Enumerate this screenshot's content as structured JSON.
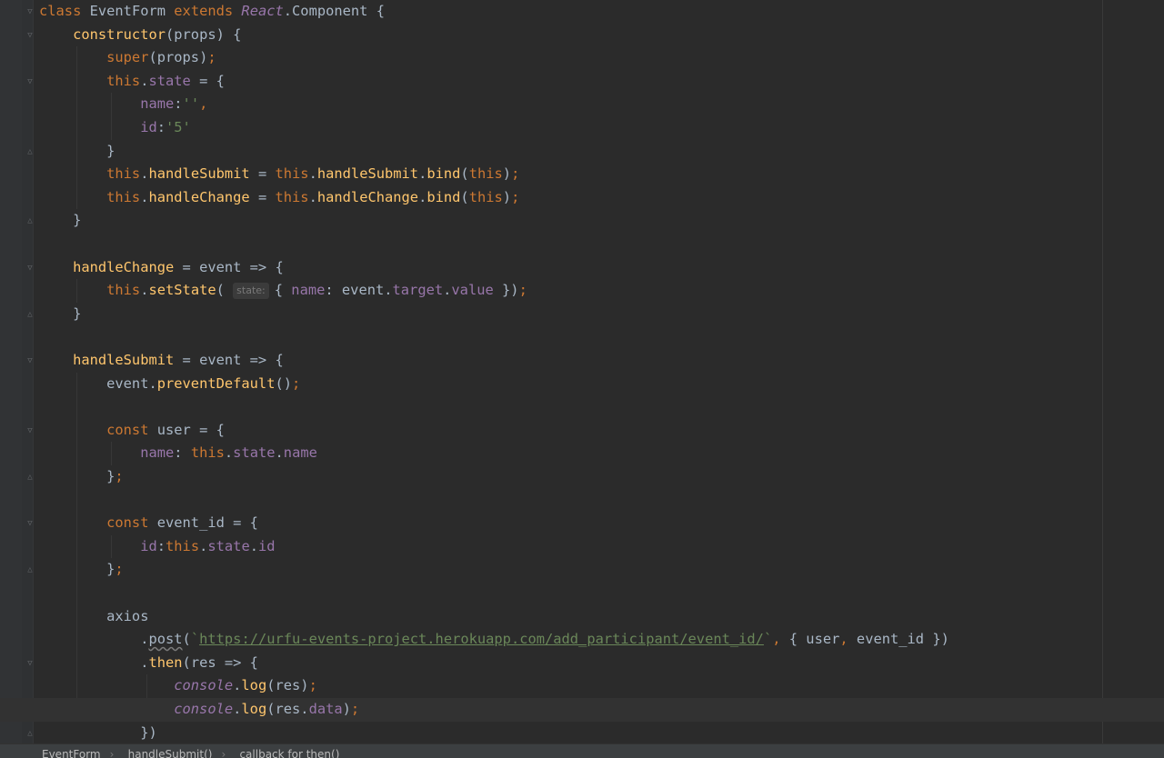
{
  "lines": [
    [
      [
        "kw",
        "class "
      ],
      [
        "cls",
        "EventForm "
      ],
      [
        "kw",
        "extends "
      ],
      [
        "react",
        "React"
      ],
      [
        "plain",
        ".Component {"
      ]
    ],
    [
      [
        "fn",
        "    constructor"
      ],
      [
        "plain",
        "(props) {"
      ]
    ],
    [
      [
        "kw",
        "        super"
      ],
      [
        "plain",
        "(props)"
      ],
      [
        "punc",
        ";"
      ]
    ],
    [
      [
        "kw",
        "        this"
      ],
      [
        "plain",
        "."
      ],
      [
        "prop",
        "state"
      ],
      [
        "plain",
        " = {"
      ]
    ],
    [
      [
        "prop",
        "            name"
      ],
      [
        "plain",
        ":"
      ],
      [
        "str",
        "''"
      ],
      [
        "punc",
        ","
      ]
    ],
    [
      [
        "prop",
        "            id"
      ],
      [
        "plain",
        ":"
      ],
      [
        "str",
        "'5'"
      ]
    ],
    [
      [
        "plain",
        "        }"
      ]
    ],
    [
      [
        "kw",
        "        this"
      ],
      [
        "plain",
        "."
      ],
      [
        "fn",
        "handleSubmit"
      ],
      [
        "plain",
        " = "
      ],
      [
        "kw",
        "this"
      ],
      [
        "plain",
        "."
      ],
      [
        "fn",
        "handleSubmit"
      ],
      [
        "plain",
        "."
      ],
      [
        "fn",
        "bind"
      ],
      [
        "plain",
        "("
      ],
      [
        "kw",
        "this"
      ],
      [
        "plain",
        ")"
      ],
      [
        "punc",
        ";"
      ]
    ],
    [
      [
        "kw",
        "        this"
      ],
      [
        "plain",
        "."
      ],
      [
        "fn",
        "handleChange"
      ],
      [
        "plain",
        " = "
      ],
      [
        "kw",
        "this"
      ],
      [
        "plain",
        "."
      ],
      [
        "fn",
        "handleChange"
      ],
      [
        "plain",
        "."
      ],
      [
        "fn",
        "bind"
      ],
      [
        "plain",
        "("
      ],
      [
        "kw",
        "this"
      ],
      [
        "plain",
        ")"
      ],
      [
        "punc",
        ";"
      ]
    ],
    [
      [
        "plain",
        "    }"
      ]
    ],
    [],
    [
      [
        "fn",
        "    handleChange"
      ],
      [
        "plain",
        " = event => {"
      ]
    ],
    [
      [
        "kw",
        "        this"
      ],
      [
        "plain",
        "."
      ],
      [
        "fn",
        "setState"
      ],
      [
        "plain",
        "( "
      ],
      [
        "hint",
        "state:"
      ],
      [
        "plain",
        "{ "
      ],
      [
        "prop",
        "name"
      ],
      [
        "plain",
        ": event."
      ],
      [
        "prop",
        "target"
      ],
      [
        "plain",
        "."
      ],
      [
        "prop",
        "value"
      ],
      [
        "plain",
        " })"
      ],
      [
        "punc",
        ";"
      ]
    ],
    [
      [
        "plain",
        "    }"
      ]
    ],
    [],
    [
      [
        "fn",
        "    handleSubmit"
      ],
      [
        "plain",
        " = event => {"
      ]
    ],
    [
      [
        "plain",
        "        event."
      ],
      [
        "fn",
        "preventDefault"
      ],
      [
        "plain",
        "()"
      ],
      [
        "punc",
        ";"
      ]
    ],
    [],
    [
      [
        "kw",
        "        const "
      ],
      [
        "plain",
        "user = {"
      ]
    ],
    [
      [
        "prop",
        "            name"
      ],
      [
        "plain",
        ": "
      ],
      [
        "kw",
        "this"
      ],
      [
        "plain",
        "."
      ],
      [
        "prop",
        "state"
      ],
      [
        "plain",
        "."
      ],
      [
        "prop",
        "name"
      ]
    ],
    [
      [
        "plain",
        "        }"
      ],
      [
        "punc",
        ";"
      ]
    ],
    [],
    [
      [
        "kw",
        "        const "
      ],
      [
        "plain",
        "event_id = {"
      ]
    ],
    [
      [
        "prop",
        "            id"
      ],
      [
        "plain",
        ":"
      ],
      [
        "kw",
        "this"
      ],
      [
        "plain",
        "."
      ],
      [
        "prop",
        "state"
      ],
      [
        "plain",
        "."
      ],
      [
        "prop",
        "id"
      ]
    ],
    [
      [
        "plain",
        "        }"
      ],
      [
        "punc",
        ";"
      ]
    ],
    [],
    [
      [
        "plain",
        "        axios"
      ]
    ],
    [
      [
        "plain",
        "            ."
      ],
      [
        "post",
        "post"
      ],
      [
        "plain",
        "("
      ],
      [
        "str",
        "`"
      ],
      [
        "url",
        "https://urfu-events-project.herokuapp.com/add_participant/event_id/"
      ],
      [
        "str",
        "`"
      ],
      [
        "punc",
        ", "
      ],
      [
        "plain",
        "{ user"
      ],
      [
        "punc",
        ", "
      ],
      [
        "plain",
        "event_id })"
      ]
    ],
    [
      [
        "plain",
        "            ."
      ],
      [
        "fn",
        "then"
      ],
      [
        "plain",
        "(res => {"
      ]
    ],
    [
      [
        "glob",
        "                console"
      ],
      [
        "plain",
        "."
      ],
      [
        "fn",
        "log"
      ],
      [
        "plain",
        "(res)"
      ],
      [
        "punc",
        ";"
      ]
    ],
    [
      [
        "glob",
        "                console"
      ],
      [
        "plain",
        "."
      ],
      [
        "fn",
        "log"
      ],
      [
        "plain",
        "(res."
      ],
      [
        "prop",
        "data"
      ],
      [
        "plain",
        ")"
      ],
      [
        "punc",
        ";"
      ]
    ],
    [
      [
        "plain",
        "            })"
      ]
    ]
  ],
  "folds": {
    "0": "open",
    "1": "open",
    "3": "open",
    "6": "close",
    "9": "close",
    "11": "open",
    "13": "close",
    "15": "open",
    "18": "open",
    "20": "close",
    "22": "open",
    "24": "close",
    "28": "open",
    "31": "close"
  },
  "current_line": 30,
  "breadcrumb": {
    "items": [
      "EventForm",
      "handleSubmit()",
      "callback for then()"
    ],
    "separator": "›"
  }
}
